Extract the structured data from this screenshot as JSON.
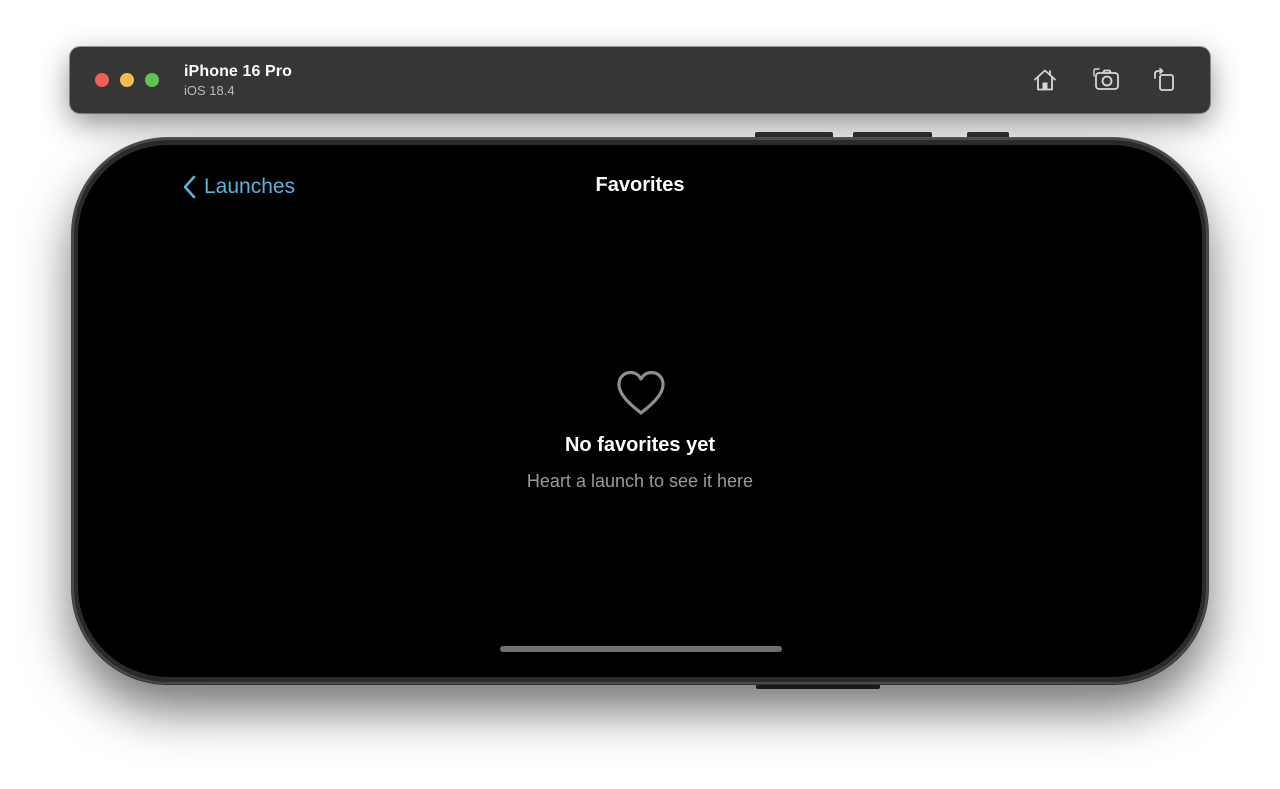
{
  "simulator": {
    "device_name": "iPhone 16 Pro",
    "os_version": "iOS 18.4",
    "toolbar_icons": [
      "home-icon",
      "screenshot-icon",
      "rotate-icon"
    ]
  },
  "app": {
    "nav": {
      "back_label": "Launches",
      "title": "Favorites"
    },
    "empty_state": {
      "icon": "heart-outline-icon",
      "title": "No favorites yet",
      "subtitle": "Heart a launch to see it here"
    }
  },
  "colors": {
    "accent": "#5ab4d8",
    "screen_background": "#000000",
    "toolbar_background": "#363636"
  }
}
